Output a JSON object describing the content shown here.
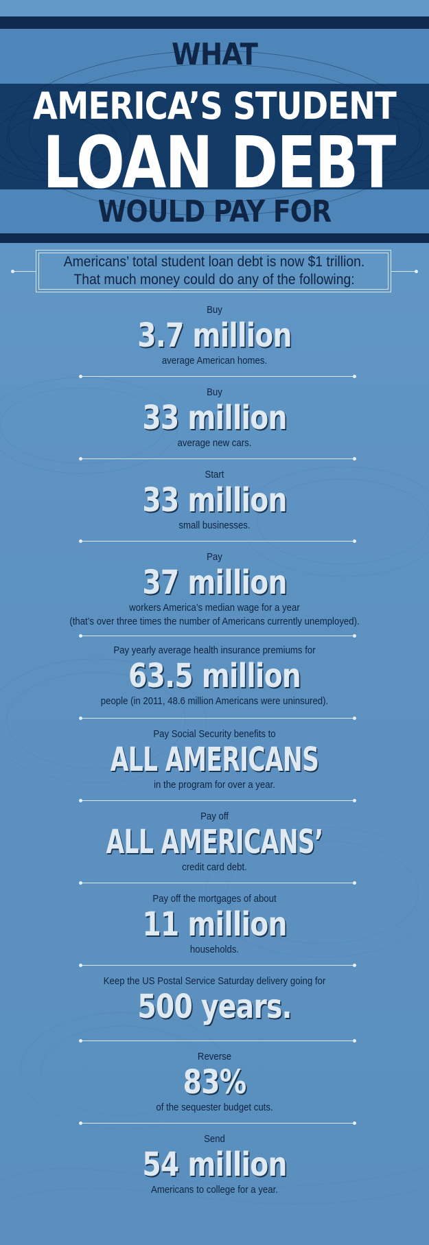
{
  "header": {
    "line1": "WHAT",
    "line2": "AMERICA’S STUDENT",
    "line3": "LOAN DEBT",
    "line4": "WOULD PAY FOR"
  },
  "intro": {
    "line1": "Americans’ total student loan debt is now $1 trillion.",
    "line2": "That much money could do any of the following:"
  },
  "items": [
    {
      "pre": "Buy",
      "big": "3.7 million",
      "post": "average American homes.",
      "post2": ""
    },
    {
      "pre": "Buy",
      "big": "33 million",
      "post": "average new cars.",
      "post2": ""
    },
    {
      "pre": "Start",
      "big": "33 million",
      "post": "small businesses.",
      "post2": ""
    },
    {
      "pre": "Pay",
      "big": "37 million",
      "post": "workers America’s median wage for a year",
      "post2": "(that’s over three times the number of Americans currently unemployed)."
    },
    {
      "pre": "Pay yearly average health insurance premiums for",
      "big": "63.5 million",
      "post": "people (in 2011, 48.6 million Americans were uninsured).",
      "post2": ""
    },
    {
      "pre": "Pay Social Security benefits to",
      "big": "ALL AMERICANS",
      "post": "in the program for over a year.",
      "post2": ""
    },
    {
      "pre": "Pay off",
      "big": "ALL AMERICANS’",
      "post": "credit card debt.",
      "post2": ""
    },
    {
      "pre": "Pay off the mortgages of about",
      "big": "11 million",
      "post": "households.",
      "post2": ""
    },
    {
      "pre": "Keep the US Postal Service Saturday delivery going for",
      "big": "500 years.",
      "post": "",
      "post2": ""
    },
    {
      "pre": "Reverse",
      "big": "83%",
      "post": "of the sequester budget cuts.",
      "post2": ""
    },
    {
      "pre": "Send",
      "big": "54 million",
      "post": "Americans to college for a year.",
      "post2": ""
    }
  ]
}
